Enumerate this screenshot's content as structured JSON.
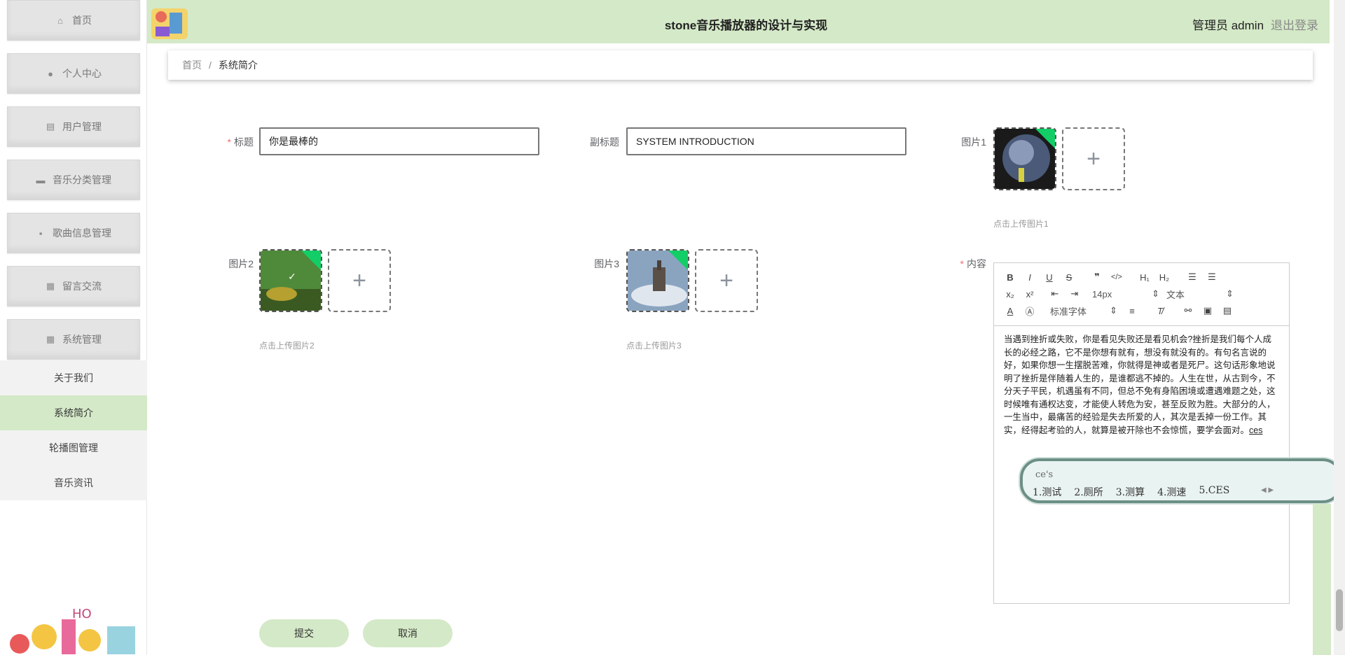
{
  "sidebar": {
    "items": [
      {
        "label": "首页",
        "icon": "home-icon",
        "glyph": "⌂"
      },
      {
        "label": "个人中心",
        "icon": "user-icon",
        "glyph": "●"
      },
      {
        "label": "用户管理",
        "icon": "clipboard-icon",
        "glyph": "▤"
      },
      {
        "label": "音乐分类管理",
        "icon": "briefcase-icon",
        "glyph": "▬"
      },
      {
        "label": "歌曲信息管理",
        "icon": "message-icon",
        "glyph": "▪"
      },
      {
        "label": "留言交流",
        "icon": "grid-icon",
        "glyph": "▦"
      },
      {
        "label": "系统管理",
        "icon": "grid-icon",
        "glyph": "▦"
      }
    ],
    "submenu": [
      {
        "label": "关于我们",
        "active": false
      },
      {
        "label": "系统简介",
        "active": true
      },
      {
        "label": "轮播图管理",
        "active": false
      },
      {
        "label": "音乐资讯",
        "active": false
      }
    ]
  },
  "header": {
    "title": "stone音乐播放器的设计与实现",
    "user": "管理员 admin",
    "logout": "退出登录"
  },
  "breadcrumb": {
    "home": "首页",
    "sep": "/",
    "current": "系统简介"
  },
  "form": {
    "title_label": "标题",
    "title_value": "你是最棒的",
    "subtitle_label": "副标题",
    "subtitle_value": "SYSTEM INTRODUCTION",
    "pic1_label": "图片1",
    "pic1_hint": "点击上传图片1",
    "pic2_label": "图片2",
    "pic2_hint": "点击上传图片2",
    "pic3_label": "图片3",
    "pic3_hint": "点击上传图片3",
    "content_label": "内容",
    "upload_plus": "+"
  },
  "editor": {
    "font_size": "14px",
    "header_select": "文本",
    "font_family": "标准字体",
    "content": "当遇到挫折或失败，你是看见失败还是看见机会?挫折是我们每个人成长的必经之路，它不是你想有就有，想没有就没有的。有句名言说的好，如果你想一生摆脱苦难，你就得是神或者是死尸。这句话形象地说明了挫折是伴随着人生的，是谁都逃不掉的。人生在世，从古到今，不分天子平民，机遇虽有不同，但总不免有身陷困境或遭遇难题之处，这时候唯有通权达变，才能使人转危为安，甚至反败为胜。大部分的人，一生当中，最痛苦的经验是失去所爱的人，其次是丢掉一份工作。其实，经得起考验的人，就算是被开除也不会惊慌，要学会面对。",
    "typed": "ces"
  },
  "ime": {
    "pinyin": "ce's",
    "candidates": [
      "1.测试",
      "2.厕所",
      "3.测算",
      "4.测速",
      "5.CES"
    ]
  },
  "buttons": {
    "submit": "提交",
    "cancel": "取消"
  },
  "colors": {
    "accent": "#d4e9c7",
    "success_corner": "#13ce66",
    "required": "#f56c6c"
  }
}
